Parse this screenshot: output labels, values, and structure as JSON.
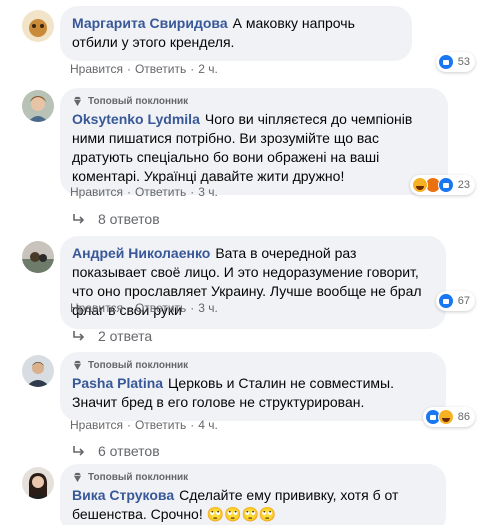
{
  "comments": [
    {
      "author": "Маргарита Свиридова",
      "text": "А маковку напрочь отбили у этого кренделя.",
      "like": "Нравится",
      "reply": "Ответить",
      "time": "2 ч.",
      "reactions": 53,
      "top_fan": ""
    },
    {
      "author": "Oksytenko Lydmila",
      "text": "Чого ви чіпляєтеся до чемпіонів ними пишатися потрібно. Ви зрозумійте що вас дратують спеціально бо вони ображені на ваші коментарі. Українці давайте жити дружно!",
      "like": "Нравится",
      "reply": "Ответить",
      "time": "3 ч.",
      "reactions": 23,
      "top_fan": "Топовый поклонник",
      "replies": "8 ответов"
    },
    {
      "author": "Андрей Николаенко",
      "text": "Вата в очередной раз показывает своё лицо. И это недоразумение говорит, что оно прославляет Украину. Лучше вообще не брал флаг в свои руки",
      "like": "Нравится",
      "reply": "Ответить",
      "time": "3 ч.",
      "reactions": 67,
      "top_fan": "",
      "replies": "2 ответа"
    },
    {
      "author": "Pasha Platina",
      "text": "Церковь и Сталин не совместимы. Значит бред в его голове не структурирован.",
      "like": "Нравится",
      "reply": "Ответить",
      "time": "4 ч.",
      "reactions": 86,
      "top_fan": "Топовый поклонник",
      "replies": "6 ответов"
    },
    {
      "author": "Вика Струкова",
      "text": "Сделайте ему прививку, хотя б от бешенства. Срочно! 🙄🙄🙄🙄",
      "top_fan": "Топовый поклонник"
    }
  ],
  "colors": {
    "author": "#385898",
    "bubble": "#f0f2f5",
    "meta": "#65676b",
    "like": "#1877f2"
  }
}
